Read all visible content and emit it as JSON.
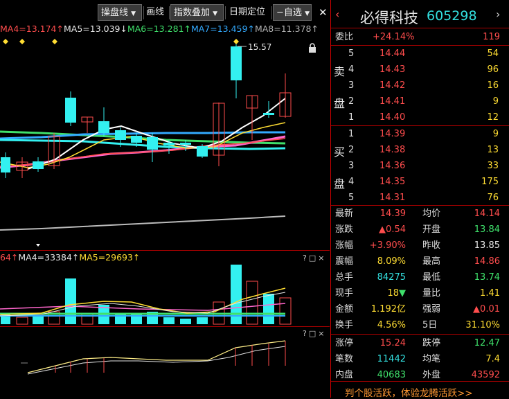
{
  "toolbar": {
    "items": [
      "操盘线",
      "画线",
      "指数叠加",
      "日期定位",
      "自选"
    ],
    "close_icon": "close-icon",
    "dropdown_icon": "chevron-down-icon"
  },
  "ma_legend": [
    {
      "label": "MA4=13.174↑",
      "color": "#ff4d4d"
    },
    {
      "label": "MA5=13.039↓",
      "color": "#e6e6e6"
    },
    {
      "label": "MA6=13.281↑",
      "color": "#3fe06b"
    },
    {
      "label": "MA7=13.459↑",
      "color": "#33aaff"
    },
    {
      "label": "MA8=11.378↑",
      "color": "#b0b0b0"
    }
  ],
  "high_label": "15.57",
  "volume_legend": [
    {
      "label": "64↑",
      "color": "#ff4d4d"
    },
    {
      "label": "MA4=33384↑",
      "color": "#e6e6e6"
    },
    {
      "label": "MA5=29693↑",
      "color": "#ffdd33"
    }
  ],
  "panel_controls": "?□×",
  "stock": {
    "name": "必得科技",
    "code": "605298"
  },
  "weibi": {
    "label": "委比",
    "value": "+24.14%",
    "diff": "119"
  },
  "sell_label": [
    "卖",
    "盘"
  ],
  "buy_label": [
    "买",
    "盘"
  ],
  "sell": [
    {
      "level": "5",
      "price": "14.44",
      "vol": "54"
    },
    {
      "level": "4",
      "price": "14.43",
      "vol": "96"
    },
    {
      "level": "3",
      "price": "14.42",
      "vol": "16"
    },
    {
      "level": "2",
      "price": "14.41",
      "vol": "9"
    },
    {
      "level": "1",
      "price": "14.40",
      "vol": "12"
    }
  ],
  "buy": [
    {
      "level": "1",
      "price": "14.39",
      "vol": "9"
    },
    {
      "level": "2",
      "price": "14.38",
      "vol": "13"
    },
    {
      "level": "3",
      "price": "14.36",
      "vol": "33"
    },
    {
      "level": "4",
      "price": "14.35",
      "vol": "175"
    },
    {
      "level": "5",
      "price": "14.31",
      "vol": "76"
    }
  ],
  "stats": [
    {
      "l1": "最新",
      "v1": "14.39",
      "c1": "red",
      "l2": "均价",
      "v2": "14.14",
      "c2": "red"
    },
    {
      "l1": "涨跌",
      "v1": "▲0.54",
      "c1": "red",
      "l2": "开盘",
      "v2": "13.84",
      "c2": "green"
    },
    {
      "l1": "涨幅",
      "v1": "+3.90%",
      "c1": "red",
      "l2": "昨收",
      "v2": "13.85",
      "c2": "white"
    },
    {
      "l1": "震幅",
      "v1": "8.09%",
      "c1": "yellow",
      "l2": "最高",
      "v2": "14.86",
      "c2": "red"
    },
    {
      "l1": "总手",
      "v1": "84275",
      "c1": "cyan",
      "l2": "最低",
      "v2": "13.74",
      "c2": "green"
    },
    {
      "l1": "现手",
      "v1": "18▼",
      "c1": "greenmix",
      "l2": "量比",
      "v2": "1.41",
      "c2": "yellow"
    },
    {
      "l1": "金额",
      "v1": "1.192亿",
      "c1": "yellow",
      "l2": "强弱",
      "v2": "▲0.01",
      "c2": "red"
    },
    {
      "l1": "换手",
      "v1": "4.56%",
      "c1": "yellow",
      "l2": "5日",
      "v2": "31.10%",
      "c2": "yellow"
    },
    {
      "l1": "涨停",
      "v1": "15.24",
      "c1": "red",
      "l2": "跌停",
      "v2": "12.47",
      "c2": "green"
    },
    {
      "l1": "笔数",
      "v1": "11442",
      "c1": "cyan",
      "l2": "均笔",
      "v2": "7.4",
      "c2": "yellow"
    },
    {
      "l1": "内盘",
      "v1": "40683",
      "c1": "green",
      "l2": "外盘",
      "v2": "43592",
      "c2": "red"
    }
  ],
  "promo": "判个股活跃，体验龙腾活跃>>",
  "colors": {
    "up": "#ff4d4d",
    "down": "#33f0f0",
    "border": "#aa0000"
  }
}
